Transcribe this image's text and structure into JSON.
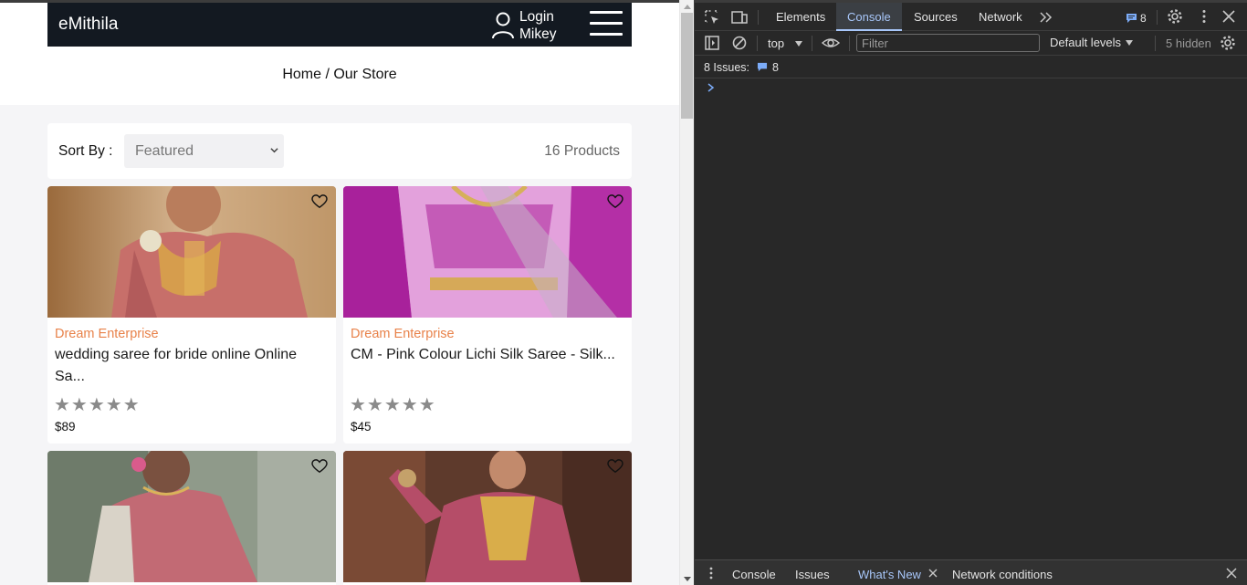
{
  "store": {
    "brand": "eMithila",
    "login_line1": "Login",
    "login_line2": "Mikey",
    "breadcrumb": "Home / Our Store",
    "sort_label": "Sort By :",
    "sort_selected": "Featured",
    "product_count": "16 Products",
    "vendor_color": "#e8824a",
    "products": [
      {
        "vendor": "Dream Enterprise",
        "title": "wedding saree for bride online Online Sa...",
        "stars": "★★★★★",
        "rating": 0,
        "price": "$89"
      },
      {
        "vendor": "Dream Enterprise",
        "title": "CM - Pink Colour Lichi Silk Saree - Silk...",
        "stars": "★★★★★",
        "rating": 0,
        "price": "$45"
      },
      {
        "vendor": "",
        "title": "",
        "stars": "",
        "rating": 0,
        "price": ""
      },
      {
        "vendor": "",
        "title": "",
        "stars": "",
        "rating": 0,
        "price": ""
      }
    ]
  },
  "devtools": {
    "tabs": [
      "Elements",
      "Console",
      "Sources",
      "Network"
    ],
    "active_tab": "Console",
    "message_count": "8",
    "context": "top",
    "filter_placeholder": "Filter",
    "levels": "Default levels",
    "hidden": "5 hidden",
    "issues_label": "8 Issues:",
    "issues_count": "8",
    "drawer_tabs": [
      "Console",
      "Issues",
      "What's New",
      "Network conditions"
    ],
    "accent": "#a8c7fa"
  }
}
